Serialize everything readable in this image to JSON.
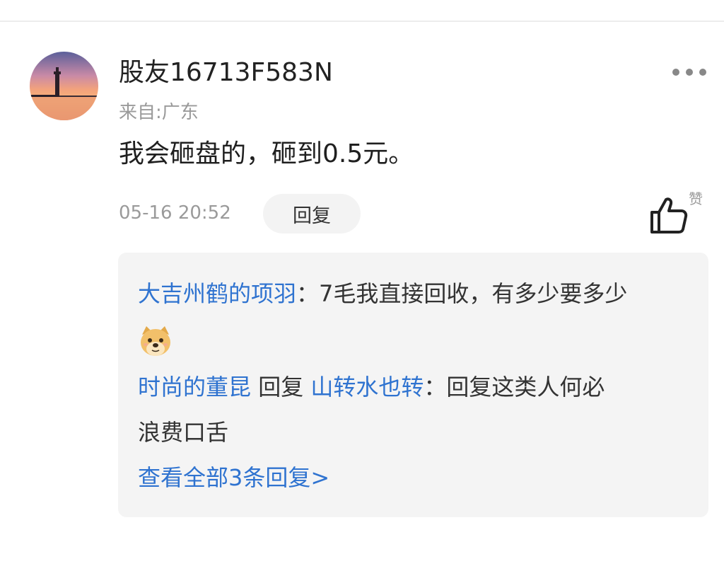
{
  "comment": {
    "username": "股友16713F583N",
    "location": "来自:广东",
    "text": "我会砸盘的，砸到0.5元。",
    "timestamp": "05-16 20:52",
    "reply_label": "回复",
    "like_label": "赞",
    "more_icon": "more-dots-icon",
    "avatar_icon": "sunset-lighthouse-avatar"
  },
  "replies": {
    "first": {
      "author": "大吉州鹤的项羽",
      "separator": "：",
      "text_line1": "7毛我直接回收，有多少要多少",
      "emoji": "doge-emoji"
    },
    "second": {
      "author": "时尚的董昆",
      "reply_word": " 回复 ",
      "target": "山转水也转",
      "separator": "：",
      "text_line1": "回复这类人何必",
      "text_line2": "浪费口舌"
    },
    "view_all_label": "查看全部3条回复>"
  },
  "colors": {
    "link_blue": "#2f73d0",
    "muted_gray": "#9a9a9a",
    "reply_bg": "#f4f4f4"
  }
}
